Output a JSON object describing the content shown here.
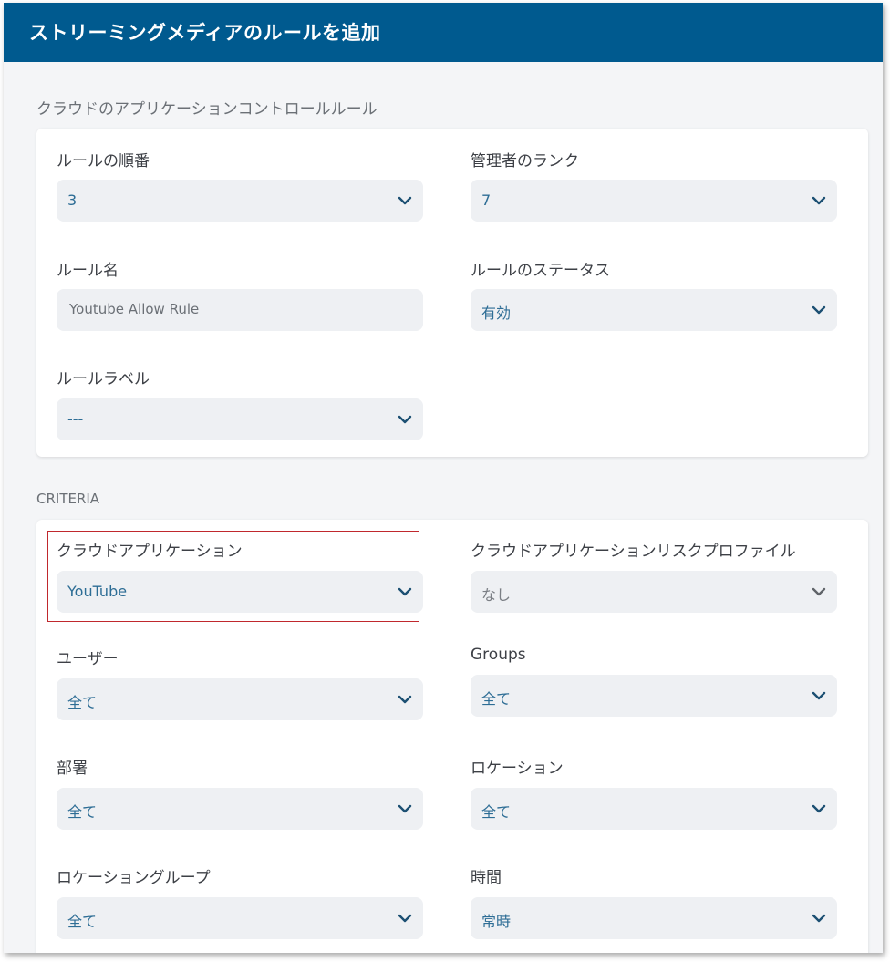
{
  "header": {
    "title": "ストリーミングメディアのルールを追加"
  },
  "rule_section": {
    "title": "クラウドのアプリケーションコントロールルール",
    "rule_order": {
      "label": "ルールの順番",
      "value": "3"
    },
    "admin_rank": {
      "label": "管理者のランク",
      "value": "7"
    },
    "rule_name": {
      "label": "ルール名",
      "value": "Youtube Allow Rule"
    },
    "rule_status": {
      "label": "ルールのステータス",
      "value": "有効"
    },
    "rule_label": {
      "label": "ルールラベル",
      "value": "---"
    }
  },
  "criteria_section": {
    "title": "CRITERIA",
    "cloud_application": {
      "label": "クラウドアプリケーション",
      "value": "YouTube"
    },
    "risk_profile": {
      "label": "クラウドアプリケーションリスクプロファイル",
      "value": "なし"
    },
    "users": {
      "label": "ユーザー",
      "value": "全て"
    },
    "groups": {
      "label": "Groups",
      "value": "全て"
    },
    "departments": {
      "label": "部署",
      "value": "全て"
    },
    "locations": {
      "label": "ロケーション",
      "value": "全て"
    },
    "location_groups": {
      "label": "ロケーショングループ",
      "value": "全て"
    },
    "time": {
      "label": "時間",
      "value": "常時"
    }
  },
  "icons": {
    "dropdown": "chevron-down-icon"
  },
  "colors": {
    "header_bg": "#005a8f",
    "value_text": "#2d6d95",
    "chevron": "#1b4f72",
    "highlight": "#c0282d"
  }
}
